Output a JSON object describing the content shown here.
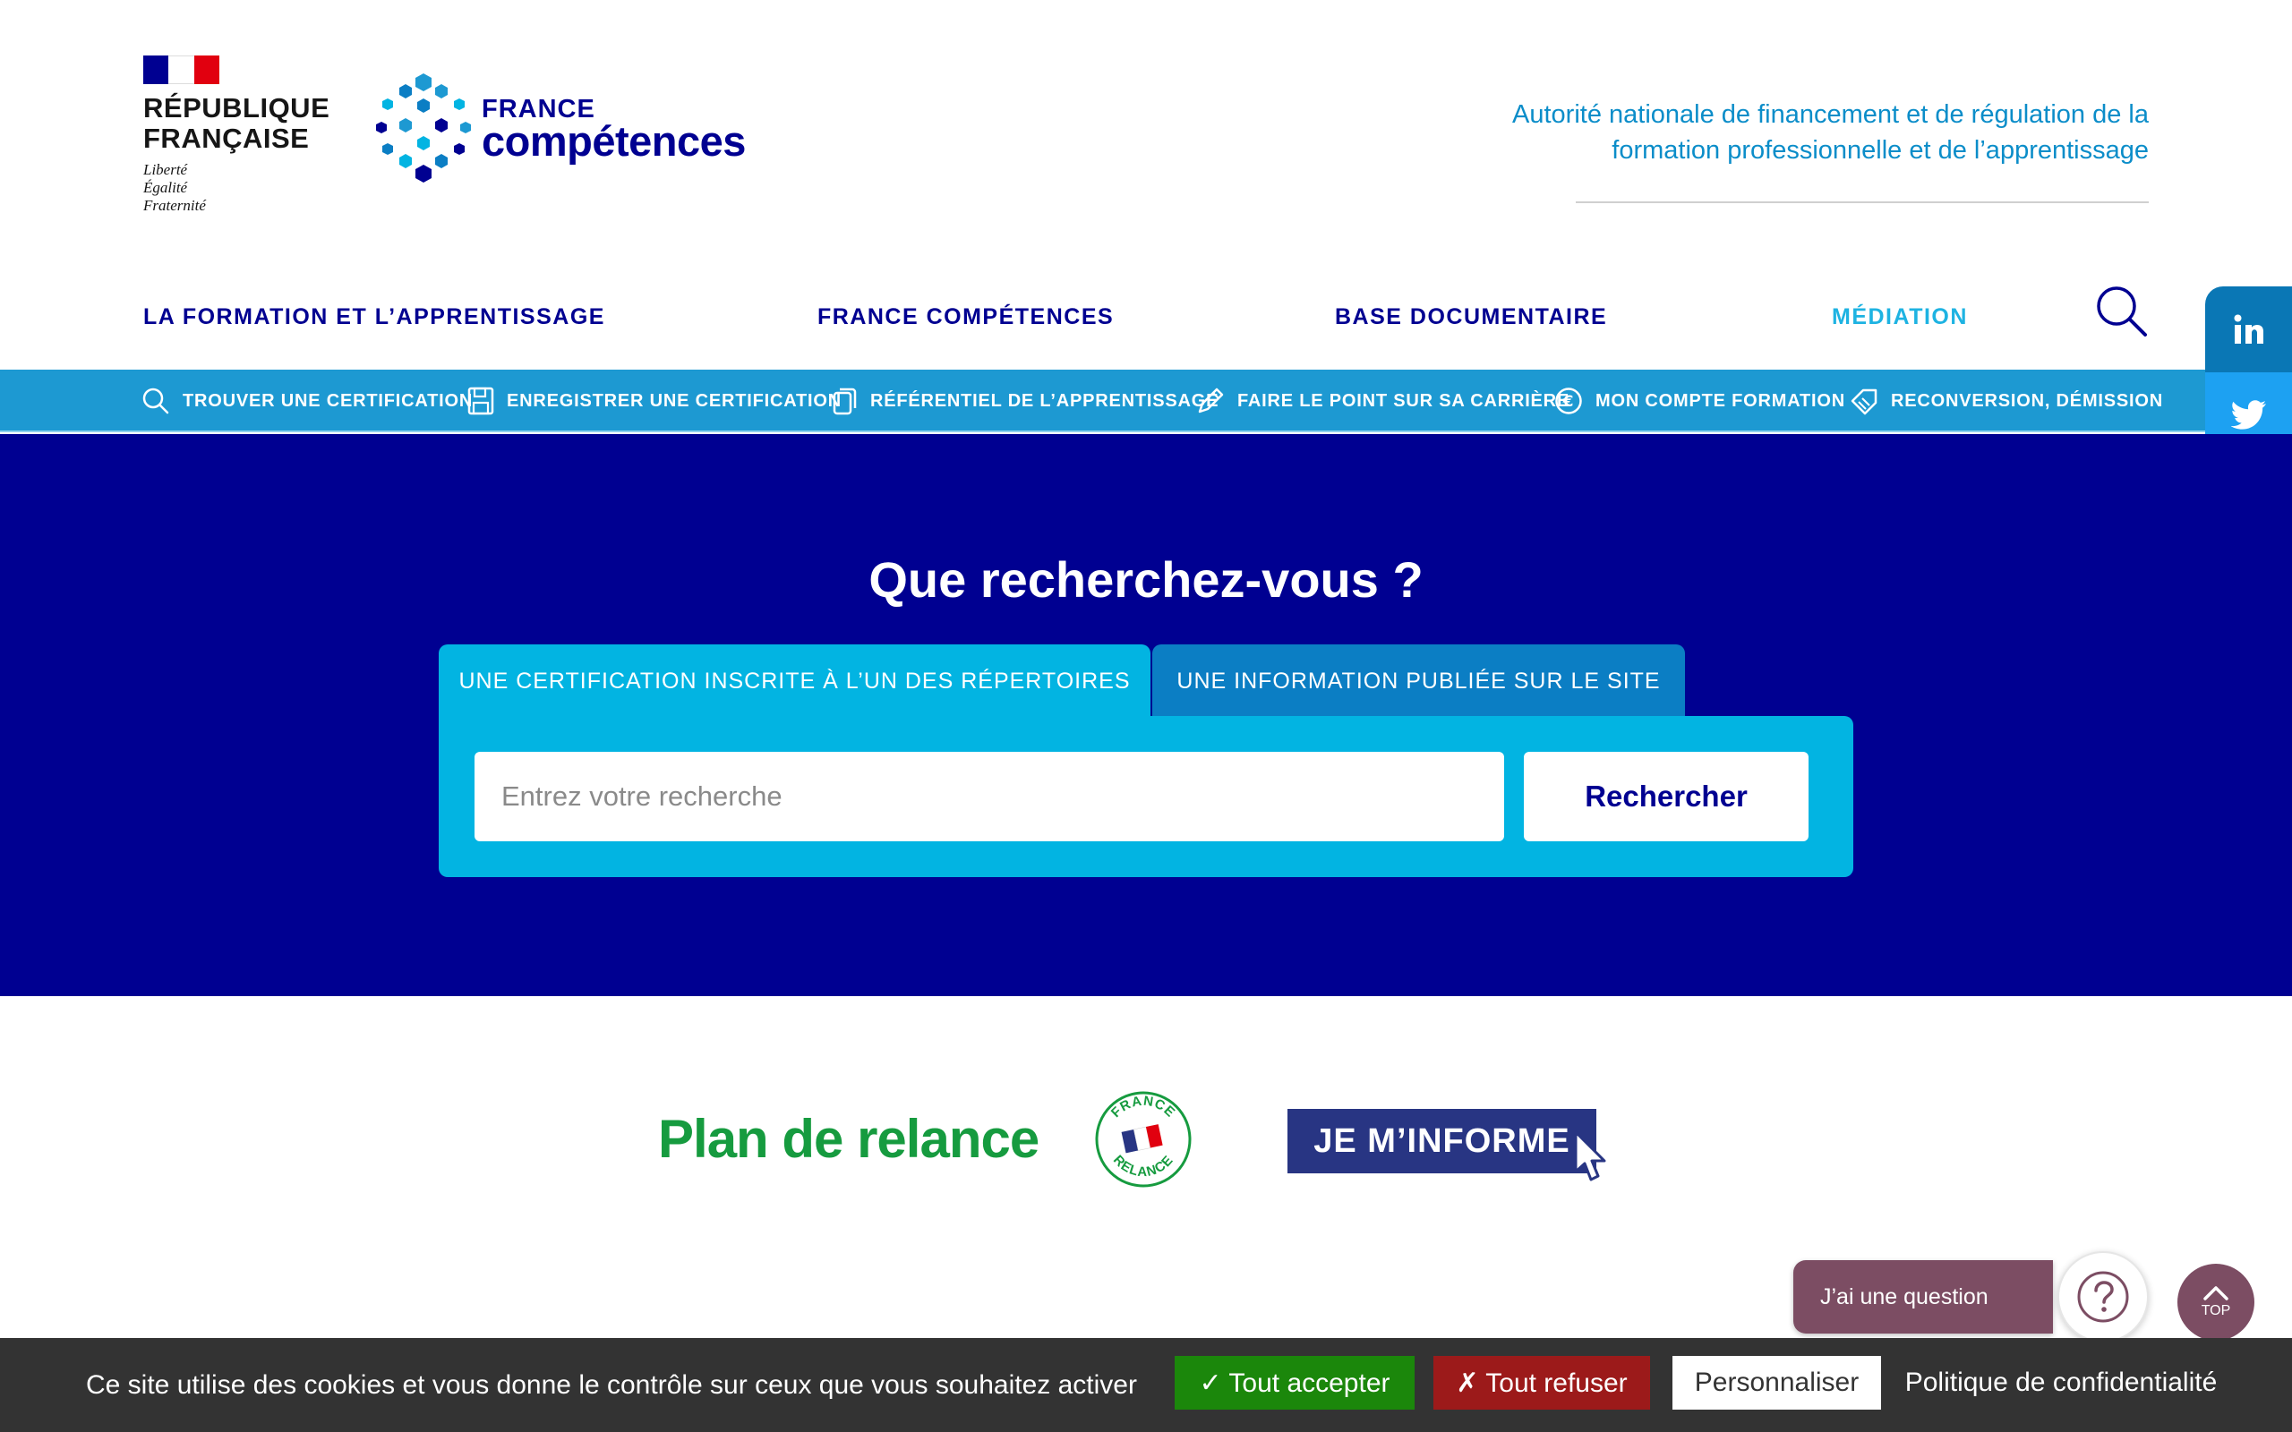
{
  "header": {
    "rf": {
      "name_line1": "RÉPUBLIQUE",
      "name_line2": "FRANÇAISE",
      "motto_line1": "Liberté",
      "motto_line2": "Égalité",
      "motto_line3": "Fraternité"
    },
    "fc": {
      "small": "FRANCE",
      "big": "compétences"
    },
    "tagline_line1": "Autorité nationale de financement et de régulation de la",
    "tagline_line2": "formation professionnelle et de l’apprentissage"
  },
  "main_nav": {
    "items": [
      {
        "label": "LA FORMATION ET L’APPRENTISSAGE"
      },
      {
        "label": "FRANCE COMPÉTENCES"
      },
      {
        "label": "BASE DOCUMENTAIRE"
      },
      {
        "label": "MÉDIATION"
      }
    ]
  },
  "sub_nav": {
    "items": [
      {
        "label": "TROUVER UNE CERTIFICATION",
        "icon": "search-icon"
      },
      {
        "label": "ENREGISTRER UNE CERTIFICATION",
        "icon": "save-icon"
      },
      {
        "label": "RÉFÉRENTIEL DE L’APPRENTISSAGE",
        "icon": "document-copy-icon"
      },
      {
        "label": "FAIRE LE POINT SUR SA CARRIÈRE",
        "icon": "pencil-icon"
      },
      {
        "label": "MON COMPTE FORMATION",
        "icon": "euro-icon"
      },
      {
        "label": "RECONVERSION, DÉMISSION",
        "icon": "tag-icon"
      }
    ]
  },
  "share": {
    "items": [
      "linkedin-icon",
      "twitter-icon",
      "facebook-icon",
      "email-icon"
    ],
    "colors": {
      "linkedin": "#0a77b5",
      "twitter": "#1da1f2",
      "facebook": "#3b5998",
      "email": "#7d7d7d"
    }
  },
  "hero": {
    "title": "Que recherchez-vous ?",
    "tabs": [
      {
        "label": "UNE CERTIFICATION INSCRITE À L’UN DES RÉPERTOIRES",
        "active": true
      },
      {
        "label": "UNE INFORMATION PUBLIÉE SUR LE SITE",
        "active": false
      }
    ],
    "search_placeholder": "Entrez votre recherche",
    "search_value": "",
    "search_button": "Rechercher"
  },
  "relance": {
    "title": "Plan de relance",
    "badge_top": "FRANCE",
    "badge_bottom": "RELANCE",
    "cta": "JE M’INFORME"
  },
  "chat": {
    "label": "J’ai une question"
  },
  "top_button": {
    "label": "TOP"
  },
  "cookie": {
    "text": "Ce site utilise des cookies et vous donne le contrôle sur ceux que vous souhaitez activer",
    "accept": "✓ Tout accepter",
    "deny": "✗ Tout refuser",
    "customize": "Personnaliser",
    "policy": "Politique de confidentialité"
  },
  "colors": {
    "brand_blue": "#000091",
    "accent_cyan": "#02b4e2",
    "subnav_blue": "#1d99d2",
    "relance_green": "#169b3f",
    "chat_plum": "#7c4d63"
  }
}
